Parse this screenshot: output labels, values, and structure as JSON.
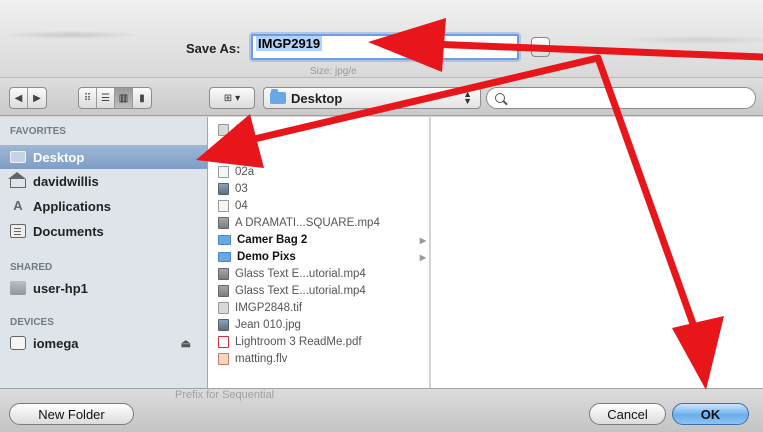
{
  "save_as": {
    "label": "Save As:",
    "value": "IMGP2919",
    "tags_ghost": "Size: jpg/e"
  },
  "toolbar": {
    "location": "Desktop",
    "search_placeholder": ""
  },
  "sidebar": {
    "favorites_heading": "FAVORITES",
    "favorites": [
      {
        "label": "Desktop",
        "icon": "desktop-icon",
        "selected": true
      },
      {
        "label": "davidwillis",
        "icon": "home-icon"
      },
      {
        "label": "Applications",
        "icon": "applications-icon"
      },
      {
        "label": "Documents",
        "icon": "documents-icon"
      }
    ],
    "shared_heading": "SHARED",
    "shared": [
      {
        "label": "user-hp1",
        "icon": "computer-icon"
      }
    ],
    "devices_heading": "DEVICES",
    "devices": [
      {
        "label": "iomega",
        "icon": "drive-icon"
      }
    ]
  },
  "files": [
    {
      "name": "01",
      "type": "tif"
    },
    {
      "name": "02",
      "type": "doc"
    },
    {
      "name": "02a",
      "type": "doc"
    },
    {
      "name": "03",
      "type": "img"
    },
    {
      "name": "04",
      "type": "doc"
    },
    {
      "name": "A DRAMATI...SQUARE.mp4",
      "type": "vid"
    },
    {
      "name": "Camer Bag 2",
      "type": "folder"
    },
    {
      "name": "Demo Pixs",
      "type": "folder"
    },
    {
      "name": "Glass Text E...utorial.mp4",
      "type": "vid"
    },
    {
      "name": "Glass Text E...utorial.mp4",
      "type": "vid"
    },
    {
      "name": "IMGP2848.tif",
      "type": "tif"
    },
    {
      "name": "Jean 010.jpg",
      "type": "img"
    },
    {
      "name": "Lightroom 3 ReadMe.pdf",
      "type": "pdf"
    },
    {
      "name": "matting.flv",
      "type": "flv"
    }
  ],
  "footer": {
    "ghost_text": "Prefix for Sequential",
    "new_folder": "New Folder",
    "cancel": "Cancel",
    "ok": "OK"
  },
  "colors": {
    "annotation_arrow": "#e8161b",
    "selection": "#7f9ec5",
    "default_button": "#6aaeeb"
  }
}
